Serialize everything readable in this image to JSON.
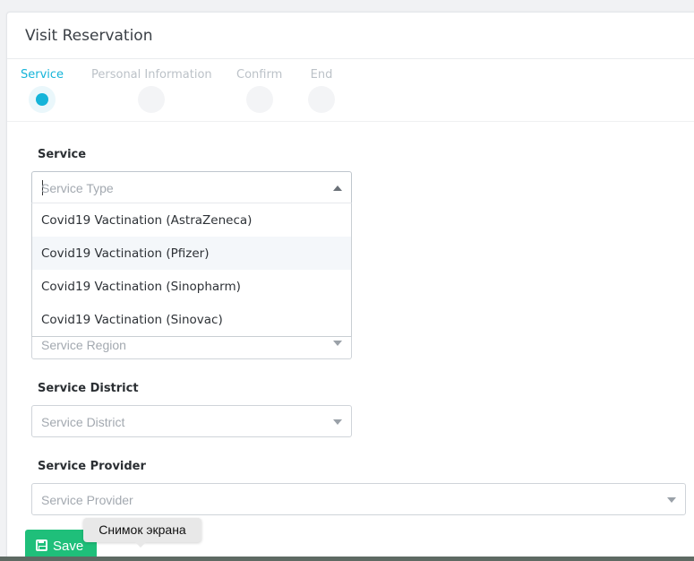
{
  "page": {
    "title": "Visit Reservation"
  },
  "stepper": {
    "steps": [
      {
        "label": "Service",
        "active": true
      },
      {
        "label": "Personal Information",
        "active": false
      },
      {
        "label": "Confirm",
        "active": false
      },
      {
        "label": "End",
        "active": false
      }
    ]
  },
  "form": {
    "service": {
      "label": "Service",
      "placeholder": "Service Type",
      "options": [
        "Covid19 Vactination (AstraZeneca)",
        "Covid19 Vactination (Pfizer)",
        "Covid19 Vactination (Sinopharm)",
        "Covid19 Vactination (Sinovac)"
      ],
      "hovered_option": "Covid19 Vactination (Pfizer)"
    },
    "region": {
      "placeholder": "Service Region"
    },
    "district": {
      "label": "Service District",
      "placeholder": "Service District"
    },
    "provider": {
      "label": "Service Provider",
      "placeholder": "Service Provider"
    },
    "save_label": "Save"
  },
  "tooltip": {
    "text": "Снимок экрана"
  },
  "colors": {
    "accent": "#15b4d9",
    "save_button": "#1fbf7a"
  },
  "icons": {
    "save": "floppy-disk-icon",
    "dropdown": "caret-down-icon"
  }
}
